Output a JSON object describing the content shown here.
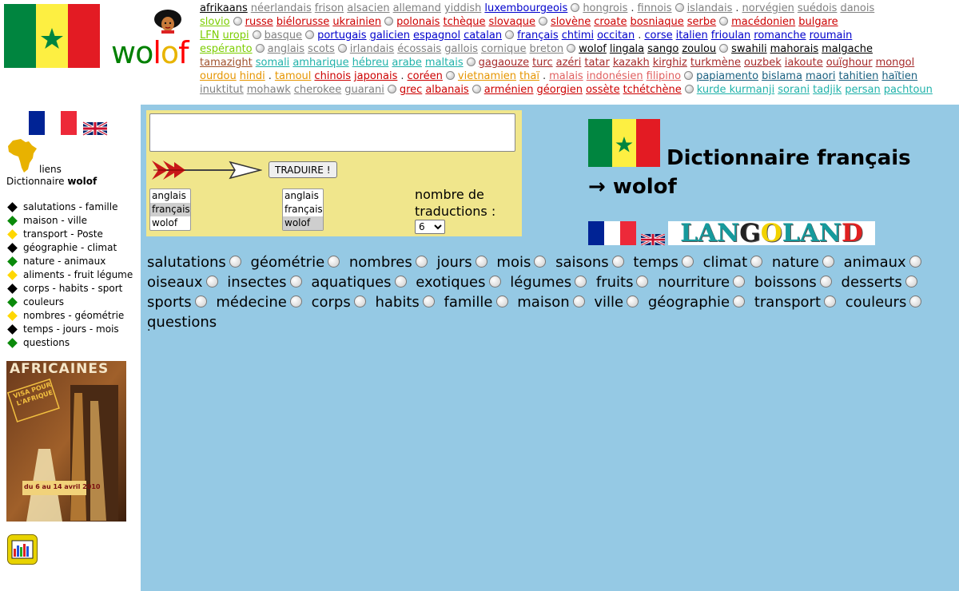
{
  "header": {
    "logo_letters": [
      {
        "t": "w",
        "c": "#008000"
      },
      {
        "t": "o",
        "c": "#008000"
      },
      {
        "t": "l",
        "c": "#ff0000"
      },
      {
        "t": "o",
        "c": "#e8b400"
      },
      {
        "t": "f",
        "c": "#ff0000"
      }
    ],
    "language_rows": [
      [
        {
          "t": "afrikaans",
          "c": "#000000"
        },
        {
          "t": "néerlandais",
          "c": "#808080"
        },
        {
          "t": "frison",
          "c": "#808080"
        },
        {
          "t": "alsacien",
          "c": "#808080"
        },
        {
          "t": "allemand",
          "c": "#808080"
        },
        {
          "t": "yiddish",
          "c": "#808080"
        },
        {
          "t": "luxembourgeois",
          "c": "#0000cc"
        },
        {
          "sep": "o"
        },
        {
          "t": "hongrois",
          "c": "#808080"
        },
        {
          "sep": "."
        },
        {
          "t": "finnois",
          "c": "#808080"
        },
        {
          "sep": "o"
        },
        {
          "t": "islandais",
          "c": "#808080"
        },
        {
          "sep": "."
        },
        {
          "t": "norvégien",
          "c": "#808080"
        },
        {
          "t": "suédois",
          "c": "#808080"
        },
        {
          "t": "danois",
          "c": "#808080"
        }
      ],
      [
        {
          "t": "slovio",
          "c": "#7ccd00"
        },
        {
          "sep": "o"
        },
        {
          "t": "russe",
          "c": "#cc0000"
        },
        {
          "t": "biélorusse",
          "c": "#cc0000"
        },
        {
          "t": "ukrainien",
          "c": "#cc0000"
        },
        {
          "sep": "o"
        },
        {
          "t": "polonais",
          "c": "#cc0000"
        },
        {
          "t": "tchèque",
          "c": "#cc0000"
        },
        {
          "t": "slovaque",
          "c": "#cc0000"
        },
        {
          "sep": "o"
        },
        {
          "t": "slovène",
          "c": "#cc0000"
        },
        {
          "t": "croate",
          "c": "#cc0000"
        },
        {
          "t": "bosniaque",
          "c": "#cc0000"
        },
        {
          "t": "serbe",
          "c": "#cc0000"
        },
        {
          "sep": "o"
        },
        {
          "t": "macédonien",
          "c": "#cc0000"
        },
        {
          "t": "bulgare",
          "c": "#cc0000"
        }
      ],
      [
        {
          "t": "LFN",
          "c": "#7ccd00"
        },
        {
          "t": "uropi",
          "c": "#7ccd00"
        },
        {
          "sep": "o"
        },
        {
          "t": "basque",
          "c": "#808080"
        },
        {
          "sep": "o"
        },
        {
          "t": "portugais",
          "c": "#0000cc"
        },
        {
          "t": "galicien",
          "c": "#0000cc"
        },
        {
          "t": "espagnol",
          "c": "#0000cc"
        },
        {
          "t": "catalan",
          "c": "#0000cc"
        },
        {
          "sep": "o"
        },
        {
          "t": "français",
          "c": "#0000cc"
        },
        {
          "t": "chtimi",
          "c": "#0000cc"
        },
        {
          "t": "occitan",
          "c": "#0000cc"
        },
        {
          "sep": "."
        },
        {
          "t": "corse",
          "c": "#0000cc"
        },
        {
          "t": "italien",
          "c": "#0000cc"
        },
        {
          "t": "frioulan",
          "c": "#0000cc"
        },
        {
          "t": "romanche",
          "c": "#0000cc"
        },
        {
          "t": "roumain",
          "c": "#0000cc"
        }
      ],
      [
        {
          "t": "espéranto",
          "c": "#7ccd00"
        },
        {
          "sep": "o"
        },
        {
          "t": "anglais",
          "c": "#808080"
        },
        {
          "t": "scots",
          "c": "#808080"
        },
        {
          "sep": "o"
        },
        {
          "t": "irlandais",
          "c": "#808080"
        },
        {
          "t": "écossais",
          "c": "#808080"
        },
        {
          "t": "gallois",
          "c": "#808080"
        },
        {
          "t": "cornique",
          "c": "#808080"
        },
        {
          "t": "breton",
          "c": "#808080"
        },
        {
          "sep": "o"
        },
        {
          "t": "wolof",
          "c": "#000000"
        },
        {
          "t": "lingala",
          "c": "#000000"
        },
        {
          "t": "sango",
          "c": "#000000"
        },
        {
          "t": "zoulou",
          "c": "#000000"
        },
        {
          "sep": "o"
        },
        {
          "t": "swahili",
          "c": "#000000"
        },
        {
          "t": "mahorais",
          "c": "#000000"
        },
        {
          "t": "malgache",
          "c": "#000000"
        }
      ],
      [
        {
          "t": "tamazight",
          "c": "#a0522d"
        },
        {
          "t": "somali",
          "c": "#20b2aa"
        },
        {
          "t": "amharique",
          "c": "#20b2aa"
        },
        {
          "t": "hébreu",
          "c": "#20b2aa"
        },
        {
          "t": "arabe",
          "c": "#20b2aa"
        },
        {
          "t": "maltais",
          "c": "#20b2aa"
        },
        {
          "sep": "o"
        },
        {
          "t": "gagaouze",
          "c": "#a52a2a"
        },
        {
          "t": "turc",
          "c": "#a52a2a"
        },
        {
          "t": "azéri",
          "c": "#a52a2a"
        },
        {
          "t": "tatar",
          "c": "#a52a2a"
        },
        {
          "t": "kazakh",
          "c": "#a52a2a"
        },
        {
          "t": "kirghiz",
          "c": "#a52a2a"
        },
        {
          "t": "turkmène",
          "c": "#a52a2a"
        },
        {
          "t": "ouzbek",
          "c": "#a52a2a"
        },
        {
          "t": "iakoute",
          "c": "#a52a2a"
        },
        {
          "t": "ouïghour",
          "c": "#a52a2a"
        },
        {
          "t": "mongol",
          "c": "#a52a2a"
        }
      ],
      [
        {
          "t": "ourdou",
          "c": "#e69500"
        },
        {
          "t": "hindi",
          "c": "#e69500"
        },
        {
          "sep": "."
        },
        {
          "t": "tamoul",
          "c": "#e69500"
        },
        {
          "t": "chinois",
          "c": "#cc0000"
        },
        {
          "t": "japonais",
          "c": "#cc0000"
        },
        {
          "sep": "."
        },
        {
          "t": "coréen",
          "c": "#cc0000"
        },
        {
          "sep": "o"
        },
        {
          "t": "vietnamien",
          "c": "#e69500"
        },
        {
          "t": "thaï",
          "c": "#e69500"
        },
        {
          "sep": "."
        },
        {
          "t": "malais",
          "c": "#e06060"
        },
        {
          "t": "indonésien",
          "c": "#e06060"
        },
        {
          "t": "filipino",
          "c": "#e06060"
        },
        {
          "sep": "o"
        },
        {
          "t": "papiamento",
          "c": "#1a6080"
        },
        {
          "t": "bislama",
          "c": "#1a6080"
        },
        {
          "t": "maori",
          "c": "#1a6080"
        },
        {
          "t": "tahitien",
          "c": "#1a6080"
        },
        {
          "t": "haïtien",
          "c": "#1a6080"
        }
      ],
      [
        {
          "t": "inuktitut",
          "c": "#808080"
        },
        {
          "t": "mohawk",
          "c": "#808080"
        },
        {
          "t": "cherokee",
          "c": "#808080"
        },
        {
          "t": "guarani",
          "c": "#808080"
        },
        {
          "sep": "o"
        },
        {
          "t": "grec",
          "c": "#cc0000"
        },
        {
          "t": "albanais",
          "c": "#cc0000"
        },
        {
          "sep": "o"
        },
        {
          "t": "arménien",
          "c": "#cc0000"
        },
        {
          "t": "géorgien",
          "c": "#cc0000"
        },
        {
          "t": "ossète",
          "c": "#cc0000"
        },
        {
          "t": "tchétchène",
          "c": "#cc0000"
        },
        {
          "sep": "o"
        },
        {
          "t": "kurde kurmanji",
          "c": "#20b2aa"
        },
        {
          "t": "sorani",
          "c": "#20b2aa"
        },
        {
          "t": "tadjik",
          "c": "#20b2aa"
        },
        {
          "t": "persan",
          "c": "#20b2aa"
        },
        {
          "t": "pachtoun",
          "c": "#20b2aa"
        }
      ]
    ]
  },
  "sidebar": {
    "links_label": "liens",
    "dict_prefix": "Dictionnaire ",
    "dict_lang": "wolof",
    "menu": [
      {
        "label": "salutations - famille",
        "color": "#000000"
      },
      {
        "label": "maison - ville",
        "color": "#0a8a0a"
      },
      {
        "label": "transport - Poste",
        "color": "#ffd700"
      },
      {
        "label": "géographie - climat",
        "color": "#000000"
      },
      {
        "label": "nature - animaux",
        "color": "#0a8a0a"
      },
      {
        "label": "aliments - fruit légume",
        "color": "#ffd700"
      },
      {
        "label": "corps - habits - sport",
        "color": "#000000"
      },
      {
        "label": "couleurs",
        "color": "#0a8a0a"
      },
      {
        "label": "nombres - géométrie",
        "color": "#ffd700"
      },
      {
        "label": "temps - jours - mois",
        "color": "#000000"
      },
      {
        "label": "questions",
        "color": "#0a8a0a"
      }
    ],
    "poster": {
      "title": "AFRICAINES",
      "stamp": "VISA POUR L'AFRIQUE",
      "dates": "du 6 au 14 avril 2010"
    }
  },
  "translator": {
    "input_value": "",
    "button_label": "TRADUIRE !",
    "source_options": [
      "anglais",
      "français",
      "wolof"
    ],
    "source_selected": "français",
    "target_options": [
      "anglais",
      "français",
      "wolof"
    ],
    "target_selected": "wolof",
    "count_label": "nombre de traductions :",
    "count_value": "6"
  },
  "main": {
    "title": "Dictionnaire français → wolof",
    "langoland_letters": [
      {
        "t": "L",
        "c": "#159a9c"
      },
      {
        "t": "A",
        "c": "#159a9c"
      },
      {
        "t": "N",
        "c": "#159a9c"
      },
      {
        "t": "G",
        "c": "#222222"
      },
      {
        "t": "O",
        "c": "#f2d200"
      },
      {
        "t": "L",
        "c": "#159a9c"
      },
      {
        "t": "A",
        "c": "#159a9c"
      },
      {
        "t": "N",
        "c": "#159a9c"
      },
      {
        "t": "D",
        "c": "#e02020"
      }
    ],
    "categories": [
      "salutations",
      "géométrie",
      "nombres",
      "jours",
      "mois",
      "saisons",
      "temps",
      "climat",
      "nature",
      "animaux",
      "oiseaux",
      "insectes",
      "aquatiques",
      "exotiques",
      "légumes",
      "fruits",
      "nourriture",
      "boissons",
      "desserts",
      "sports",
      "médecine",
      "corps",
      "habits",
      "famille",
      "maison",
      "ville",
      "géographie",
      "transport",
      "couleurs",
      "questions"
    ],
    "trailing_text": "."
  },
  "colors": {
    "main_bg": "#95c9e4",
    "translator_bg": "#f0e68c",
    "senegal_green": "#00853f",
    "senegal_yellow": "#fdef42",
    "senegal_red": "#e31b23"
  }
}
